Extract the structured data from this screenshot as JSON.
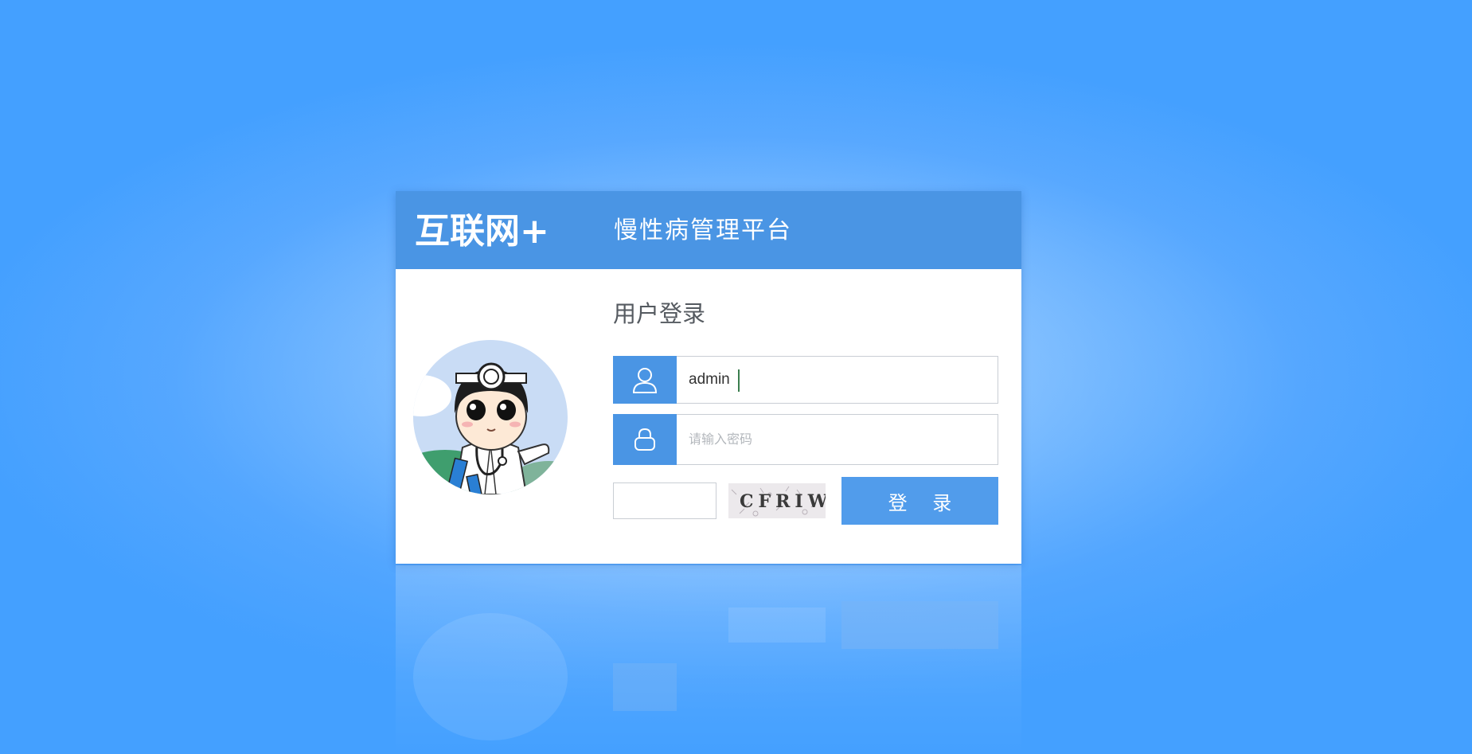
{
  "header": {
    "brand": "互联网+",
    "platform_title": "慢性病管理平台"
  },
  "login": {
    "heading": "用户登录",
    "username_value": "admin",
    "password_placeholder": "请输入密码",
    "captcha_value": "",
    "captcha_text": "CFRIW",
    "submit_label": "登 录"
  },
  "icons": {
    "user": "user-icon",
    "lock": "lock-icon",
    "avatar": "doctor-avatar-icon"
  },
  "colors": {
    "background": "#44a0ff",
    "header": "#4a95e4",
    "button": "#519ceb",
    "heading_text": "#555a60"
  }
}
